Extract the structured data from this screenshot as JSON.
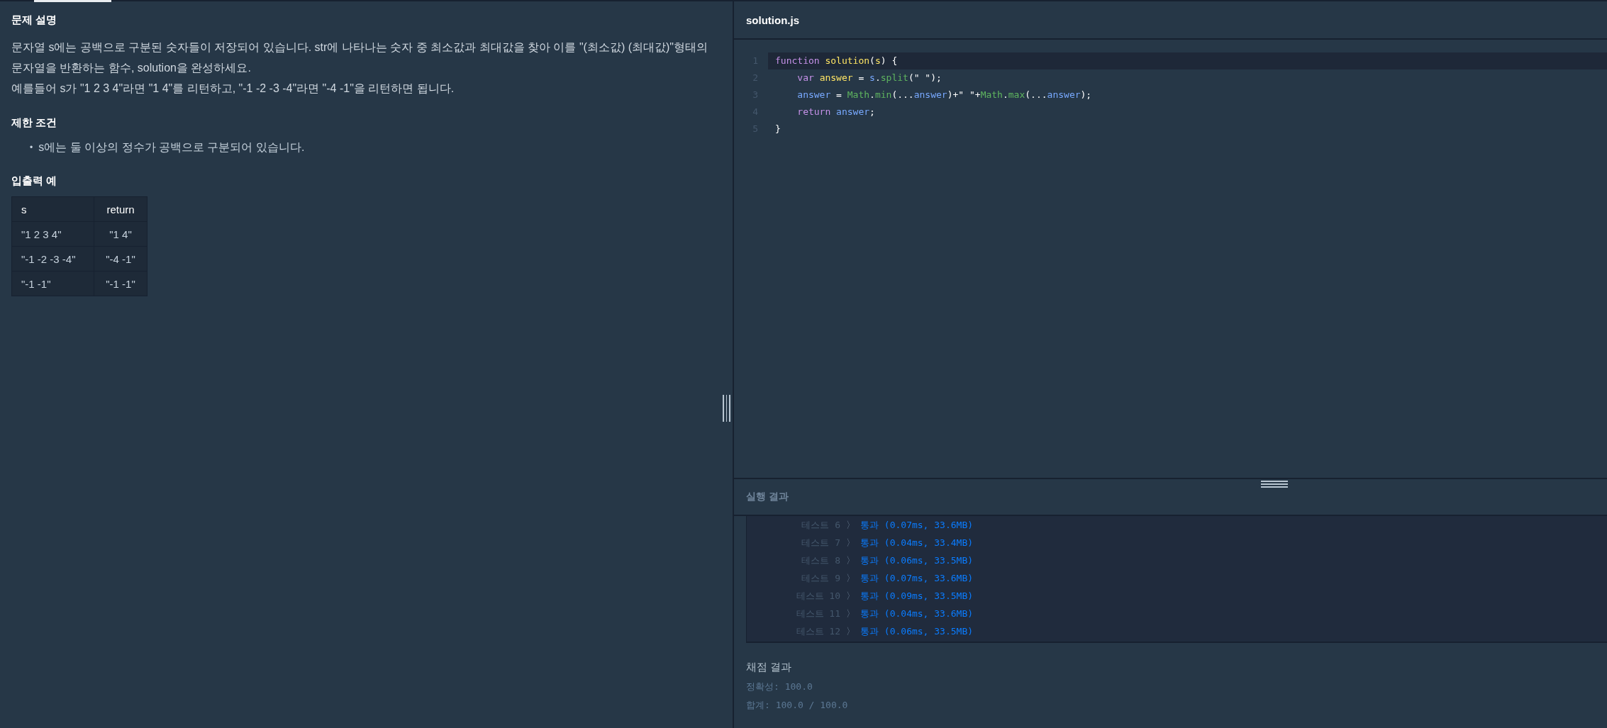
{
  "problem": {
    "title": "문제 설명",
    "paragraphs": [
      "문자열 s에는 공백으로 구분된 숫자들이 저장되어 있습니다. str에 나타나는 숫자 중 최소값과 최대값을 찾아 이를 \"(최소값) (최대값)\"형태의 문자열을 반환하는 함수, solution을 완성하세요.",
      "예를들어 s가 \"1 2 3 4\"라면 \"1 4\"를 리턴하고, \"-1 -2 -3 -4\"라면 \"-4 -1\"을 리턴하면 됩니다."
    ],
    "constraints_title": "제한 조건",
    "constraints": [
      {
        "marker": "•",
        "text": "s에는 둘 이상의 정수가 공백으로 구분되어 있습니다."
      }
    ],
    "examples_title": "입출력 예",
    "table": {
      "columns": [
        "s",
        "return"
      ],
      "rows": [
        [
          "\"1 2 3 4\"",
          "\"1 4\""
        ],
        [
          "\"-1 -2 -3 -4\"",
          "\"-4 -1\""
        ],
        [
          "\"-1 -1\"",
          "\"-1 -1\""
        ]
      ]
    }
  },
  "editor": {
    "filename": "solution.js",
    "lines": [
      {
        "number": "1",
        "highlighted": true,
        "tokens": [
          {
            "kind": "keyword",
            "text": "function "
          },
          {
            "kind": "name",
            "text": "solution"
          },
          {
            "kind": "plain",
            "text": "("
          },
          {
            "kind": "name",
            "text": "s"
          },
          {
            "kind": "plain",
            "text": ") {"
          }
        ]
      },
      {
        "number": "2",
        "highlighted": false,
        "tokens": [
          {
            "kind": "keyword",
            "text": "    var "
          },
          {
            "kind": "name",
            "text": "answer"
          },
          {
            "kind": "plain",
            "text": " = "
          },
          {
            "kind": "variable",
            "text": "s"
          },
          {
            "kind": "plain",
            "text": "."
          },
          {
            "kind": "builtin",
            "text": "split"
          },
          {
            "kind": "plain",
            "text": "(\" \");"
          }
        ]
      },
      {
        "number": "3",
        "highlighted": false,
        "tokens": [
          {
            "kind": "variable",
            "text": "    answer"
          },
          {
            "kind": "plain",
            "text": " = "
          },
          {
            "kind": "builtin",
            "text": "Math"
          },
          {
            "kind": "plain",
            "text": "."
          },
          {
            "kind": "builtin",
            "text": "min"
          },
          {
            "kind": "plain",
            "text": "(..."
          },
          {
            "kind": "variable",
            "text": "answer"
          },
          {
            "kind": "plain",
            "text": ")+\" \"+"
          },
          {
            "kind": "builtin",
            "text": "Math"
          },
          {
            "kind": "plain",
            "text": "."
          },
          {
            "kind": "builtin",
            "text": "max"
          },
          {
            "kind": "plain",
            "text": "(..."
          },
          {
            "kind": "variable",
            "text": "answer"
          },
          {
            "kind": "plain",
            "text": ");"
          }
        ]
      },
      {
        "number": "4",
        "highlighted": false,
        "tokens": [
          {
            "kind": "keyword",
            "text": "    return "
          },
          {
            "kind": "variable",
            "text": "answer"
          },
          {
            "kind": "plain",
            "text": ";"
          }
        ]
      },
      {
        "number": "5",
        "highlighted": false,
        "tokens": [
          {
            "kind": "plain",
            "text": "}"
          }
        ]
      }
    ]
  },
  "results": {
    "title": "실행 결과",
    "tests": [
      {
        "label": "테스트 6",
        "arrow": "〉",
        "result": "통과 (0.07ms, 33.6MB)"
      },
      {
        "label": "테스트 7",
        "arrow": "〉",
        "result": "통과 (0.04ms, 33.4MB)"
      },
      {
        "label": "테스트 8",
        "arrow": "〉",
        "result": "통과 (0.06ms, 33.5MB)"
      },
      {
        "label": "테스트 9",
        "arrow": "〉",
        "result": "통과 (0.07ms, 33.6MB)"
      },
      {
        "label": "테스트 10",
        "arrow": "〉",
        "result": "통과 (0.09ms, 33.5MB)"
      },
      {
        "label": "테스트 11",
        "arrow": "〉",
        "result": "통과 (0.04ms, 33.6MB)"
      },
      {
        "label": "테스트 12",
        "arrow": "〉",
        "result": "통과 (0.06ms, 33.5MB)"
      }
    ]
  },
  "grading": {
    "title": "채점 결과",
    "lines": [
      "정확성: 100.0",
      "합계: 100.0 / 100.0"
    ]
  }
}
